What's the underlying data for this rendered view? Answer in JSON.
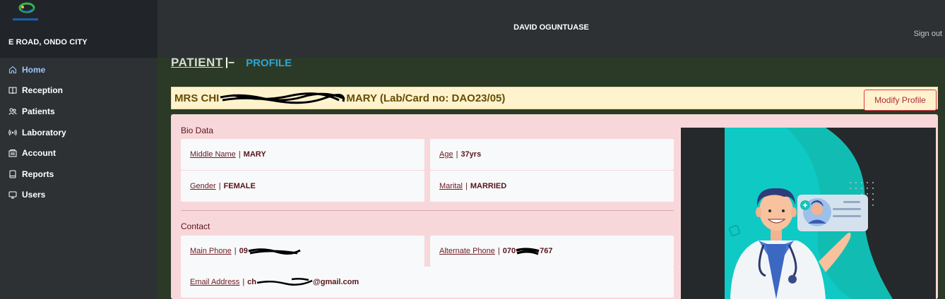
{
  "sidebar": {
    "org_name": "E ROAD, ONDO CITY",
    "items": [
      {
        "label": "Home",
        "icon": "home-icon",
        "active": true
      },
      {
        "label": "Reception",
        "icon": "book-icon"
      },
      {
        "label": "Patients",
        "icon": "people-icon"
      },
      {
        "label": "Laboratory",
        "icon": "broadcast-icon"
      },
      {
        "label": "Account",
        "icon": "bank-icon"
      },
      {
        "label": "Reports",
        "icon": "journal-icon"
      },
      {
        "label": "Users",
        "icon": "display-icon"
      }
    ]
  },
  "header": {
    "user_name": "DAVID OGUNTUASE",
    "signout": "Sign out"
  },
  "page": {
    "title": "PATIENT",
    "title_sep": "|–",
    "subtitle": "PROFILE"
  },
  "banner": {
    "prefix": "MRS CHI",
    "suffix": "MARY (Lab/Card no: DAO23/05)",
    "modify_label": "Modify Profile"
  },
  "bio": {
    "title": "Bio Data",
    "middle_name": {
      "label": "Middle Name",
      "value": "MARY"
    },
    "age": {
      "label": "Age",
      "value": "37yrs"
    },
    "gender": {
      "label": "Gender",
      "value": "FEMALE"
    },
    "marital": {
      "label": "Marital",
      "value": "MARRIED"
    }
  },
  "contact": {
    "title": "Contact",
    "main_phone": {
      "label": "Main Phone",
      "value_start": "09",
      "value_end": ""
    },
    "alt_phone": {
      "label": "Alternate Phone",
      "value_start": "070",
      "value_end": "767"
    },
    "email": {
      "label": "Email Address",
      "value_start": "ch",
      "value_end": "@gmail.com"
    }
  },
  "colors": {
    "banner_bg": "#fff3cd",
    "panel_bg": "#f8d7da",
    "accent_profile": "#2fa3d6",
    "active_nav": "#9ec5fe"
  }
}
